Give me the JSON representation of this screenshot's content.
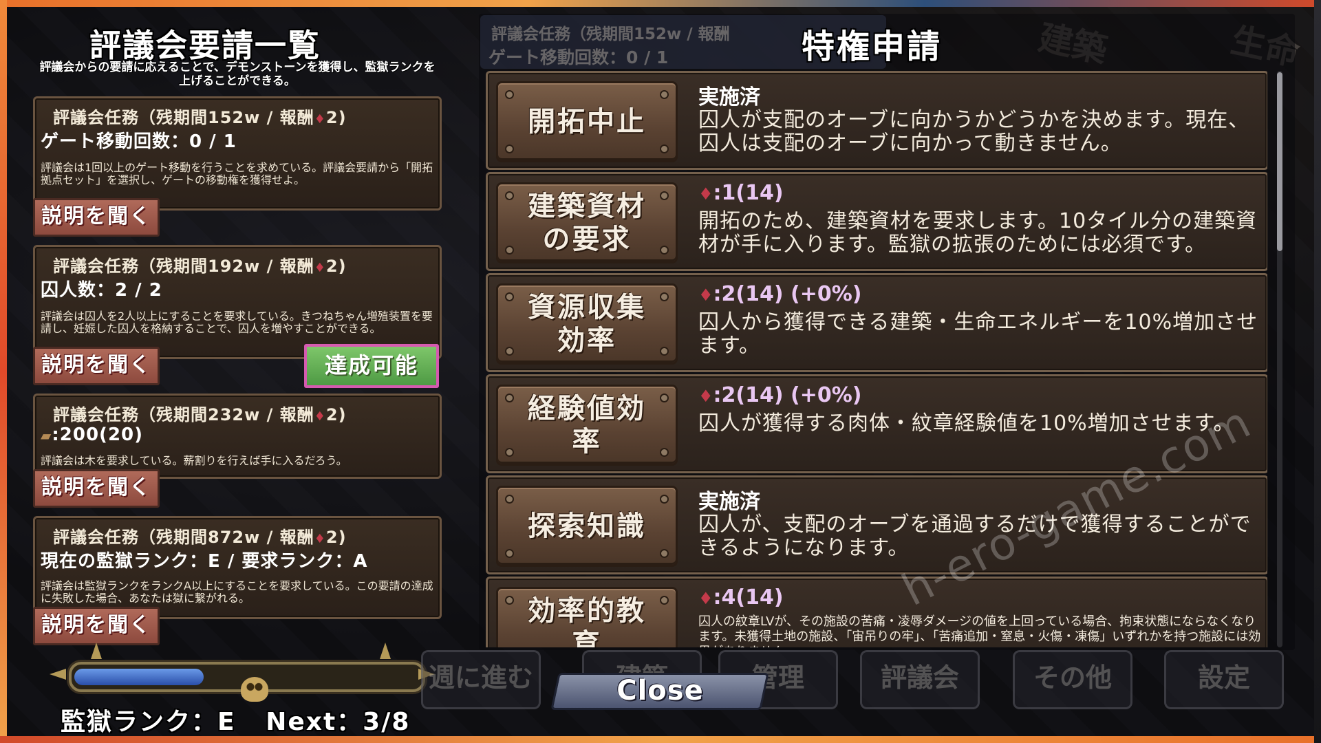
{
  "left_panel": {
    "title": "評議会要請一覧",
    "intro": "評議会からの要請に応えることで、デモンストーンを獲得し、監獄ランクを上げることができる。",
    "missions": [
      {
        "header": "評議会任務（残期間152w / 報酬",
        "reward": "2)",
        "line": "ゲート移動回数：0 / 1",
        "desc": "評議会は1回以上のゲート移動を行うことを求めている。評議会要請から「開拓拠点セット」を選択し、ゲートの移動権を獲得せよ。",
        "button": "説明を聞く"
      },
      {
        "header": "評議会任務（残期間192w / 報酬",
        "reward": "2)",
        "line": "囚人数：2 / 2",
        "desc": "評議会は囚人を2人以上にすることを要求している。きつねちゃん増殖装置を要請し、妊娠した囚人を格納することで、囚人を増やすことができる。",
        "button": "説明を聞く",
        "achieve_button": "達成可能"
      },
      {
        "header": "評議会任務（残期間232w / 報酬",
        "reward": "2)",
        "line": ":200(20)",
        "desc": "評議会は木を要求している。薪割りを行えば手に入るだろう。",
        "button": "説明を聞く"
      },
      {
        "header": "評議会任務（残期間872w / 報酬",
        "reward": "2)",
        "line": "現在の監獄ランク：E / 要求ランク：A",
        "desc": "評議会は監獄ランクをランクA以上にすることを要求している。この要請の達成に失敗した場合、あなたは獄に繋がれる。",
        "button": "説明を聞く"
      }
    ],
    "rank_label": "監獄ランク：E",
    "next_label": "Next：3/8",
    "rank_progress": 0.375
  },
  "right_panel": {
    "title": "特権申請",
    "ghost_header_line1": "評議会任務（残期間152w / 報酬",
    "ghost_header_line2": "ゲート移動回数：0 / 1",
    "privileges": [
      {
        "name_line1": "開拓中止",
        "name_line2": "",
        "status": "実施済",
        "cost": "",
        "desc": "囚人が支配のオーブに向かうかどうかを決めます。現在、囚人は支配のオーブに向かって動きません。"
      },
      {
        "name_line1": "建築資材",
        "name_line2": "の要求",
        "status": "",
        "cost": ":1(14)",
        "desc": "開拓のため、建築資材を要求します。10タイル分の建築資材が手に入ります。監獄の拡張のためには必須です。"
      },
      {
        "name_line1": "資源収集",
        "name_line2": "効率",
        "status": "",
        "cost": ":2(14) (+0%)",
        "desc": "囚人から獲得できる建築・生命エネルギーを10%増加させます。"
      },
      {
        "name_line1": "経験値効",
        "name_line2": "率",
        "status": "",
        "cost": ":2(14) (+0%)",
        "desc": "囚人が獲得する肉体・紋章経験値を10%増加させます。"
      },
      {
        "name_line1": "探索知識",
        "name_line2": "",
        "status": "実施済",
        "cost": "",
        "desc": "囚人が、支配のオーブを通過するだけで獲得することができるようになります。"
      },
      {
        "name_line1": "効率的教",
        "name_line2": "育",
        "status": "",
        "cost": ":4(14)",
        "desc": "囚人の紋章LVが、その施設の苦痛・凌辱ダメージの値を上回っている場合、拘束状態にならなくなります。未獲得土地の施設、「宙吊りの牢」、「苦痛追加・窒息・火傷・凍傷」いずれかを持つ施設には効果がありません。"
      }
    ]
  },
  "background": {
    "ghost_words": [
      "建築",
      "生命"
    ],
    "menu_items": [
      "週に進む",
      "建築",
      "管理",
      "評議会",
      "その他",
      "設定"
    ]
  },
  "close_button": "Close",
  "watermark": "h-ero-game.com",
  "colors": {
    "panel_bg": "#2b221c",
    "panel_border": "#74604c",
    "ask_button": "#8d4a3e",
    "achieve_button": "#4e9a44",
    "achieve_border": "#d55ab0",
    "gauge_fill": "#2a4ea8",
    "gem": "#c43a4a"
  }
}
